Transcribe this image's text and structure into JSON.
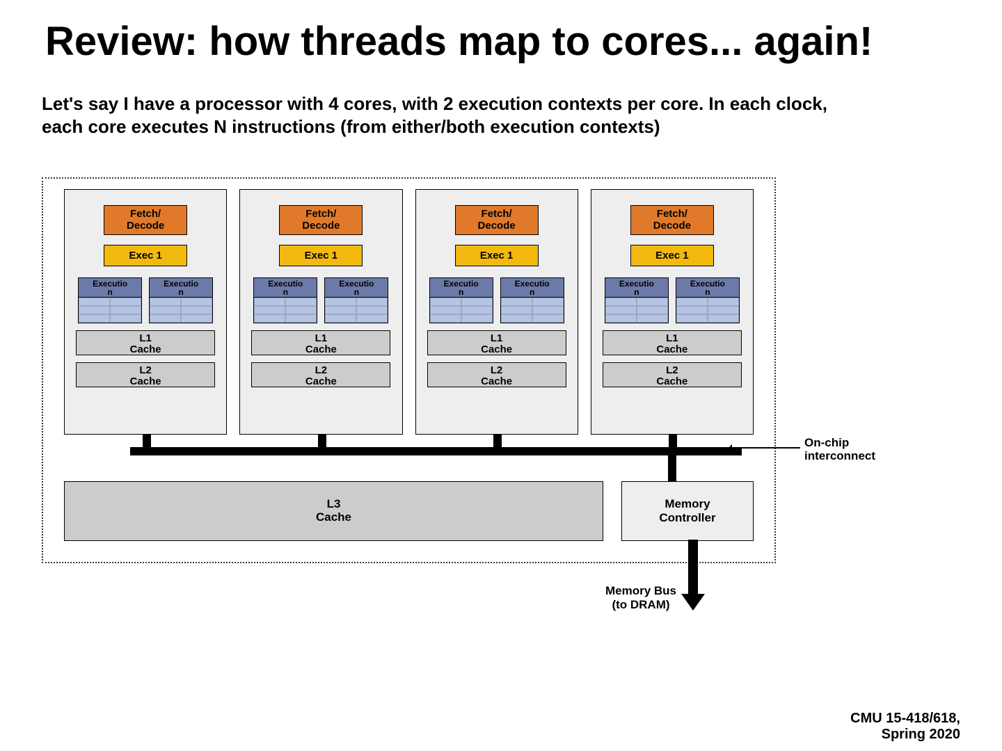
{
  "title": "Review: how threads map to cores... again!",
  "subtitle": "Let's say I have a processor with 4 cores, with 2 execution contexts per core. In each clock, each core executes N instructions (from either/both execution contexts)",
  "core": {
    "fetch": "Fetch/\nDecode",
    "exec": "Exec 1",
    "ctx": "Executio\nn",
    "l1": "L1\nCache",
    "l2": "L2\nCache"
  },
  "l3": "L3\nCache",
  "memctrl": "Memory\nController",
  "onchip": "On-chip\ninterconnect",
  "membus": "Memory Bus (to DRAM)",
  "footer1": "CMU 15-418/618,",
  "footer2": "Spring 2020",
  "colors": {
    "fetch": "#e07a2a",
    "exec": "#f2b90f",
    "ctx_header": "#6b7aa8",
    "ctx_body": "#b6c4e2",
    "cache": "#cccccc",
    "core_bg": "#eeeeee"
  }
}
